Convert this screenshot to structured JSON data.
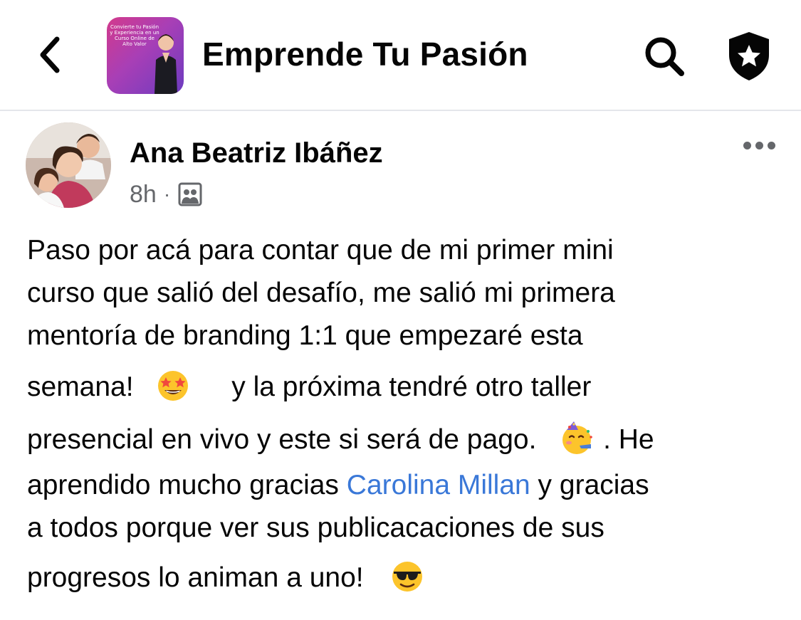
{
  "header": {
    "back_icon": "chevron-left-icon",
    "group_name": "Emprende Tu Pasión",
    "group_thumbnail_text": "Convierte tu Pasión y Experiencia en un Curso Online de Alto Valor",
    "search_icon": "search-icon",
    "shield_icon": "shield-star-icon"
  },
  "post": {
    "author": "Ana Beatriz Ibáñez",
    "time": "8h",
    "separator": "·",
    "audience_icon": "group-members-icon",
    "more_icon": "more-options-icon",
    "lines": [
      {
        "text": "Paso por acá para contar que de mi primer mini"
      },
      {
        "text": "curso que salió del desafío, me salió mi primera"
      },
      {
        "text": "mentoría de branding 1:1 que empezaré esta"
      },
      {
        "before": "semana!",
        "emoji": "star-struck-emoji",
        "after": "y la próxima tendré otro taller"
      },
      {
        "before": "presencial en vivo y este si será de pago.",
        "emoji": "partying-face-emoji",
        "after": ".  He"
      },
      {
        "before": "aprendido mucho  gracias ",
        "mention": "Carolina Millan",
        "after": " y gracias"
      },
      {
        "text": "a todos porque ver sus publicacaciones de sus"
      },
      {
        "before": "progresos lo animan a uno!",
        "emoji": "sunglasses-face-emoji"
      }
    ]
  },
  "colors": {
    "text": "#050505",
    "secondary": "#65676b",
    "mention": "#3a78d8",
    "divider": "#e4e6eb"
  }
}
